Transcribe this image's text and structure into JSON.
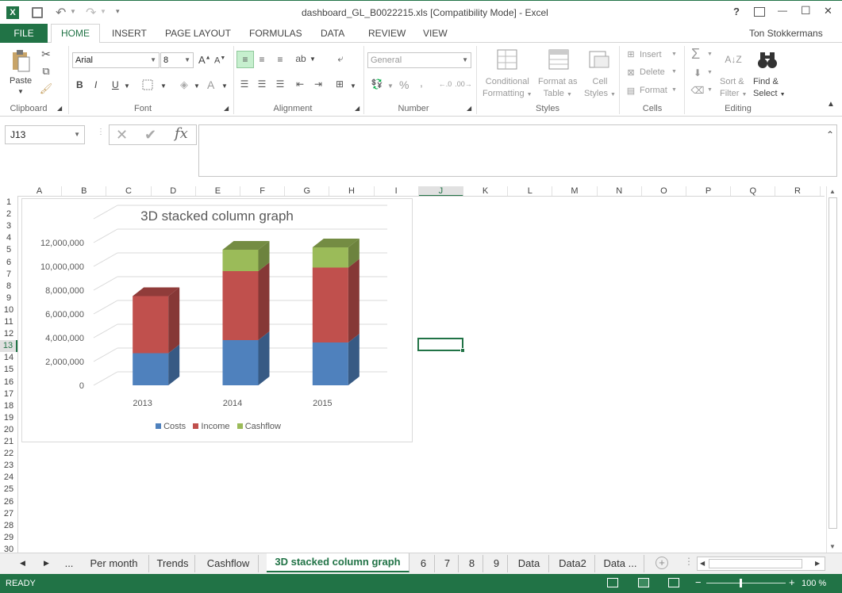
{
  "titlebar": {
    "title": "dashboard_GL_B0022215.xls  [Compatibility Mode] - Excel",
    "help": "?",
    "minimize": "—",
    "maximize": "☐",
    "close": "✕"
  },
  "tabs": {
    "file": "FILE",
    "items": [
      "HOME",
      "INSERT",
      "PAGE LAYOUT",
      "FORMULAS",
      "DATA",
      "REVIEW",
      "VIEW"
    ],
    "user": "Ton  Stokkermans"
  },
  "ribbon": {
    "clipboard": {
      "paste": "Paste",
      "label": "Clipboard"
    },
    "font": {
      "name": "Arial",
      "size": "8",
      "label": "Font",
      "bold": "B",
      "italic": "I",
      "underline": "U"
    },
    "alignment": {
      "label": "Alignment"
    },
    "number": {
      "format": "General",
      "label": "Number",
      "percent": "%",
      "comma": ","
    },
    "styles": {
      "cond1": "Conditional",
      "cond2": "Formatting",
      "fmt1": "Format as",
      "fmt2": "Table",
      "cell1": "Cell",
      "cell2": "Styles",
      "label": "Styles"
    },
    "cells": {
      "insert": "Insert",
      "delete": "Delete",
      "format": "Format",
      "label": "Cells"
    },
    "editing": {
      "sort1": "Sort &",
      "sort2": "Filter",
      "find1": "Find &",
      "find2": "Select",
      "label": "Editing"
    }
  },
  "formula": {
    "namebox": "J13",
    "fx": "fx",
    "value": ""
  },
  "columns": [
    "A",
    "B",
    "C",
    "D",
    "E",
    "F",
    "G",
    "H",
    "I",
    "J",
    "K",
    "L",
    "M",
    "N",
    "O",
    "P",
    "Q",
    "R"
  ],
  "rows": [
    "1",
    "2",
    "3",
    "4",
    "5",
    "6",
    "7",
    "8",
    "9",
    "10",
    "11",
    "12",
    "13",
    "14",
    "15",
    "16",
    "17",
    "18",
    "19",
    "20",
    "21",
    "22",
    "23",
    "24",
    "25",
    "26",
    "27",
    "28",
    "29",
    "30"
  ],
  "selected_cell": "J13",
  "chart_data": {
    "type": "bar",
    "title": "3D stacked column graph",
    "categories": [
      "2013",
      "2014",
      "2015"
    ],
    "series": [
      {
        "name": "Costs",
        "values": [
          2700000,
          3800000,
          3600000
        ],
        "color": "#4f81bd"
      },
      {
        "name": "Income",
        "values": [
          4800000,
          5800000,
          6300000
        ],
        "color": "#c0504d"
      },
      {
        "name": "Cashflow",
        "values": [
          0,
          1800000,
          1700000
        ],
        "color": "#9bbb59"
      }
    ],
    "ylim": [
      0,
      14000000
    ],
    "yticks": [
      "0",
      "2,000,000",
      "4,000,000",
      "6,000,000",
      "8,000,000",
      "10,000,000",
      "12,000,000"
    ],
    "grid": true,
    "legend_position": "bottom"
  },
  "sheet_tabs": [
    "...",
    "Per month",
    "Trends",
    "Cashflow",
    "3D stacked column graph",
    "6",
    "7",
    "8",
    "9",
    "Data",
    "Data2",
    "Data ..."
  ],
  "active_sheet": "3D stacked column graph",
  "status": {
    "ready": "READY",
    "zoom": "100 %"
  }
}
